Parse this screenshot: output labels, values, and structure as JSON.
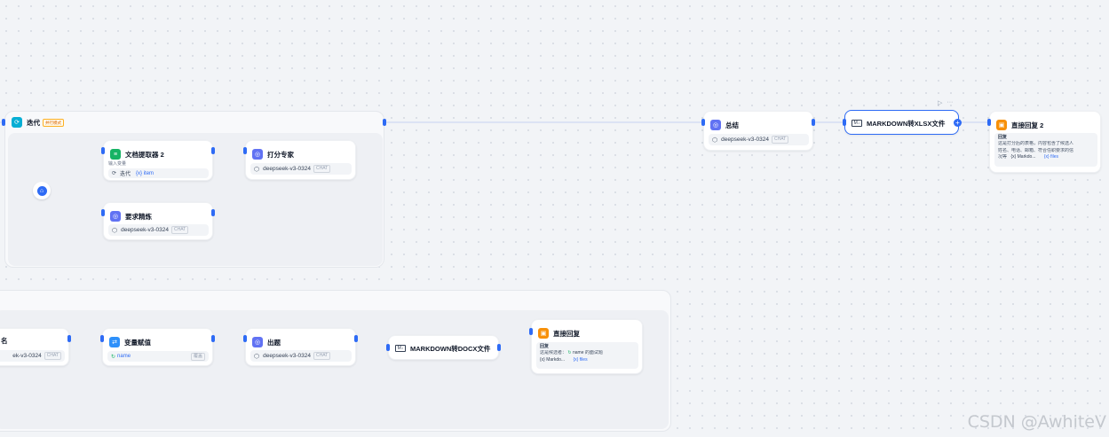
{
  "iteration": {
    "title": "迭代",
    "badge": "并行模式"
  },
  "nodes": {
    "doc_extractor": {
      "title": "文档提取器 2",
      "label": "输入变量",
      "var_source": "迭代",
      "var_name": "{x} item"
    },
    "requirement_refine": {
      "title": "要求精炼",
      "model": "deepseek-v3-0324",
      "mode": "CHAT"
    },
    "scoring_expert": {
      "title": "打分专家",
      "model": "deepseek-v3-0324",
      "mode": "CHAT"
    },
    "summary": {
      "title": "总结",
      "model": "deepseek-v3-0324",
      "mode": "CHAT"
    },
    "md_to_xlsx": {
      "title": "MARKDOWN转XLSX文件",
      "icon_text": "M↓"
    },
    "direct_reply_2": {
      "title": "直接回复 2",
      "label": "回复",
      "text_line1": "这是打分后的表格，内容包含了候选人",
      "text_line2": "姓名、电话、邮箱、符合任职要求的信",
      "text_line3_prefix": "况等",
      "var1": "{x} Markdo...",
      "var2": "{x} files"
    },
    "llm_partial": {
      "title_fragment": "名",
      "model_fragment": "ek-v3-0324",
      "mode": "CHAT"
    },
    "var_assign": {
      "title": "变量赋值",
      "var_name": "name",
      "op": "覆盖"
    },
    "question": {
      "title": "出题",
      "model": "deepseek-v3-0324",
      "mode": "CHAT"
    },
    "md_to_docx": {
      "title": "MARKDOWN转DOCX文件",
      "icon_text": "M↓"
    },
    "direct_reply": {
      "title": "直接回复",
      "label": "回复",
      "text_prefix": "这是候选者：",
      "text_var": "name",
      "text_suffix": "的面试题",
      "var1": "{x} Markdo...",
      "var2": "{x} files"
    }
  },
  "toolbar": {
    "run_icon": "▷",
    "more_icon": "···"
  },
  "watermark": "CSDN @AwhiteV",
  "colors": {
    "accent": "#2e6bf5",
    "llm": "#6172f3",
    "doc": "#16b364",
    "variable": "#2e90fa",
    "answer": "#f79009",
    "iteration": "#06aed4"
  }
}
